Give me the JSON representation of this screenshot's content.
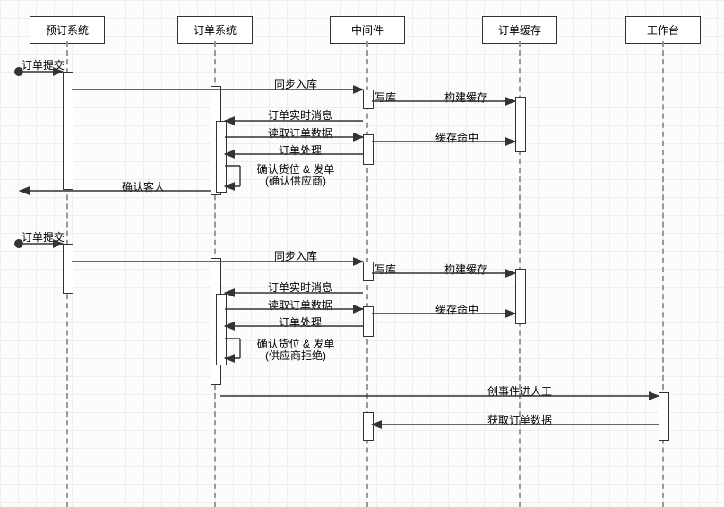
{
  "participants": {
    "booking": "预订系统",
    "order": "订单系统",
    "middleware": "中间件",
    "cache": "订单缓存",
    "workbench": "工作台"
  },
  "flow1": {
    "submit": "订单提交",
    "syncStore": "同步入库",
    "writeDb": "写库",
    "buildCache": "构建缓存",
    "realtimeMsg": "订单实时消息",
    "readOrder": "读取订单数据",
    "cacheHit": "缓存命中",
    "process": "订单处理",
    "confirmA": "确认货位 & 发单",
    "confirmB": "(确认供应商)",
    "confirmGuest": "确认客人"
  },
  "flow2": {
    "submit": "订单提交",
    "syncStore": "同步入库",
    "writeDb": "写库",
    "buildCache": "构建缓存",
    "realtimeMsg": "订单实时消息",
    "readOrder": "读取订单数据",
    "cacheHit": "缓存命中",
    "process": "订单处理",
    "confirmA": "确认货位 & 发单",
    "confirmB": "(供应商拒绝)",
    "createTicket": "创事件进人工",
    "fetchOrder": "获取订单数据"
  }
}
